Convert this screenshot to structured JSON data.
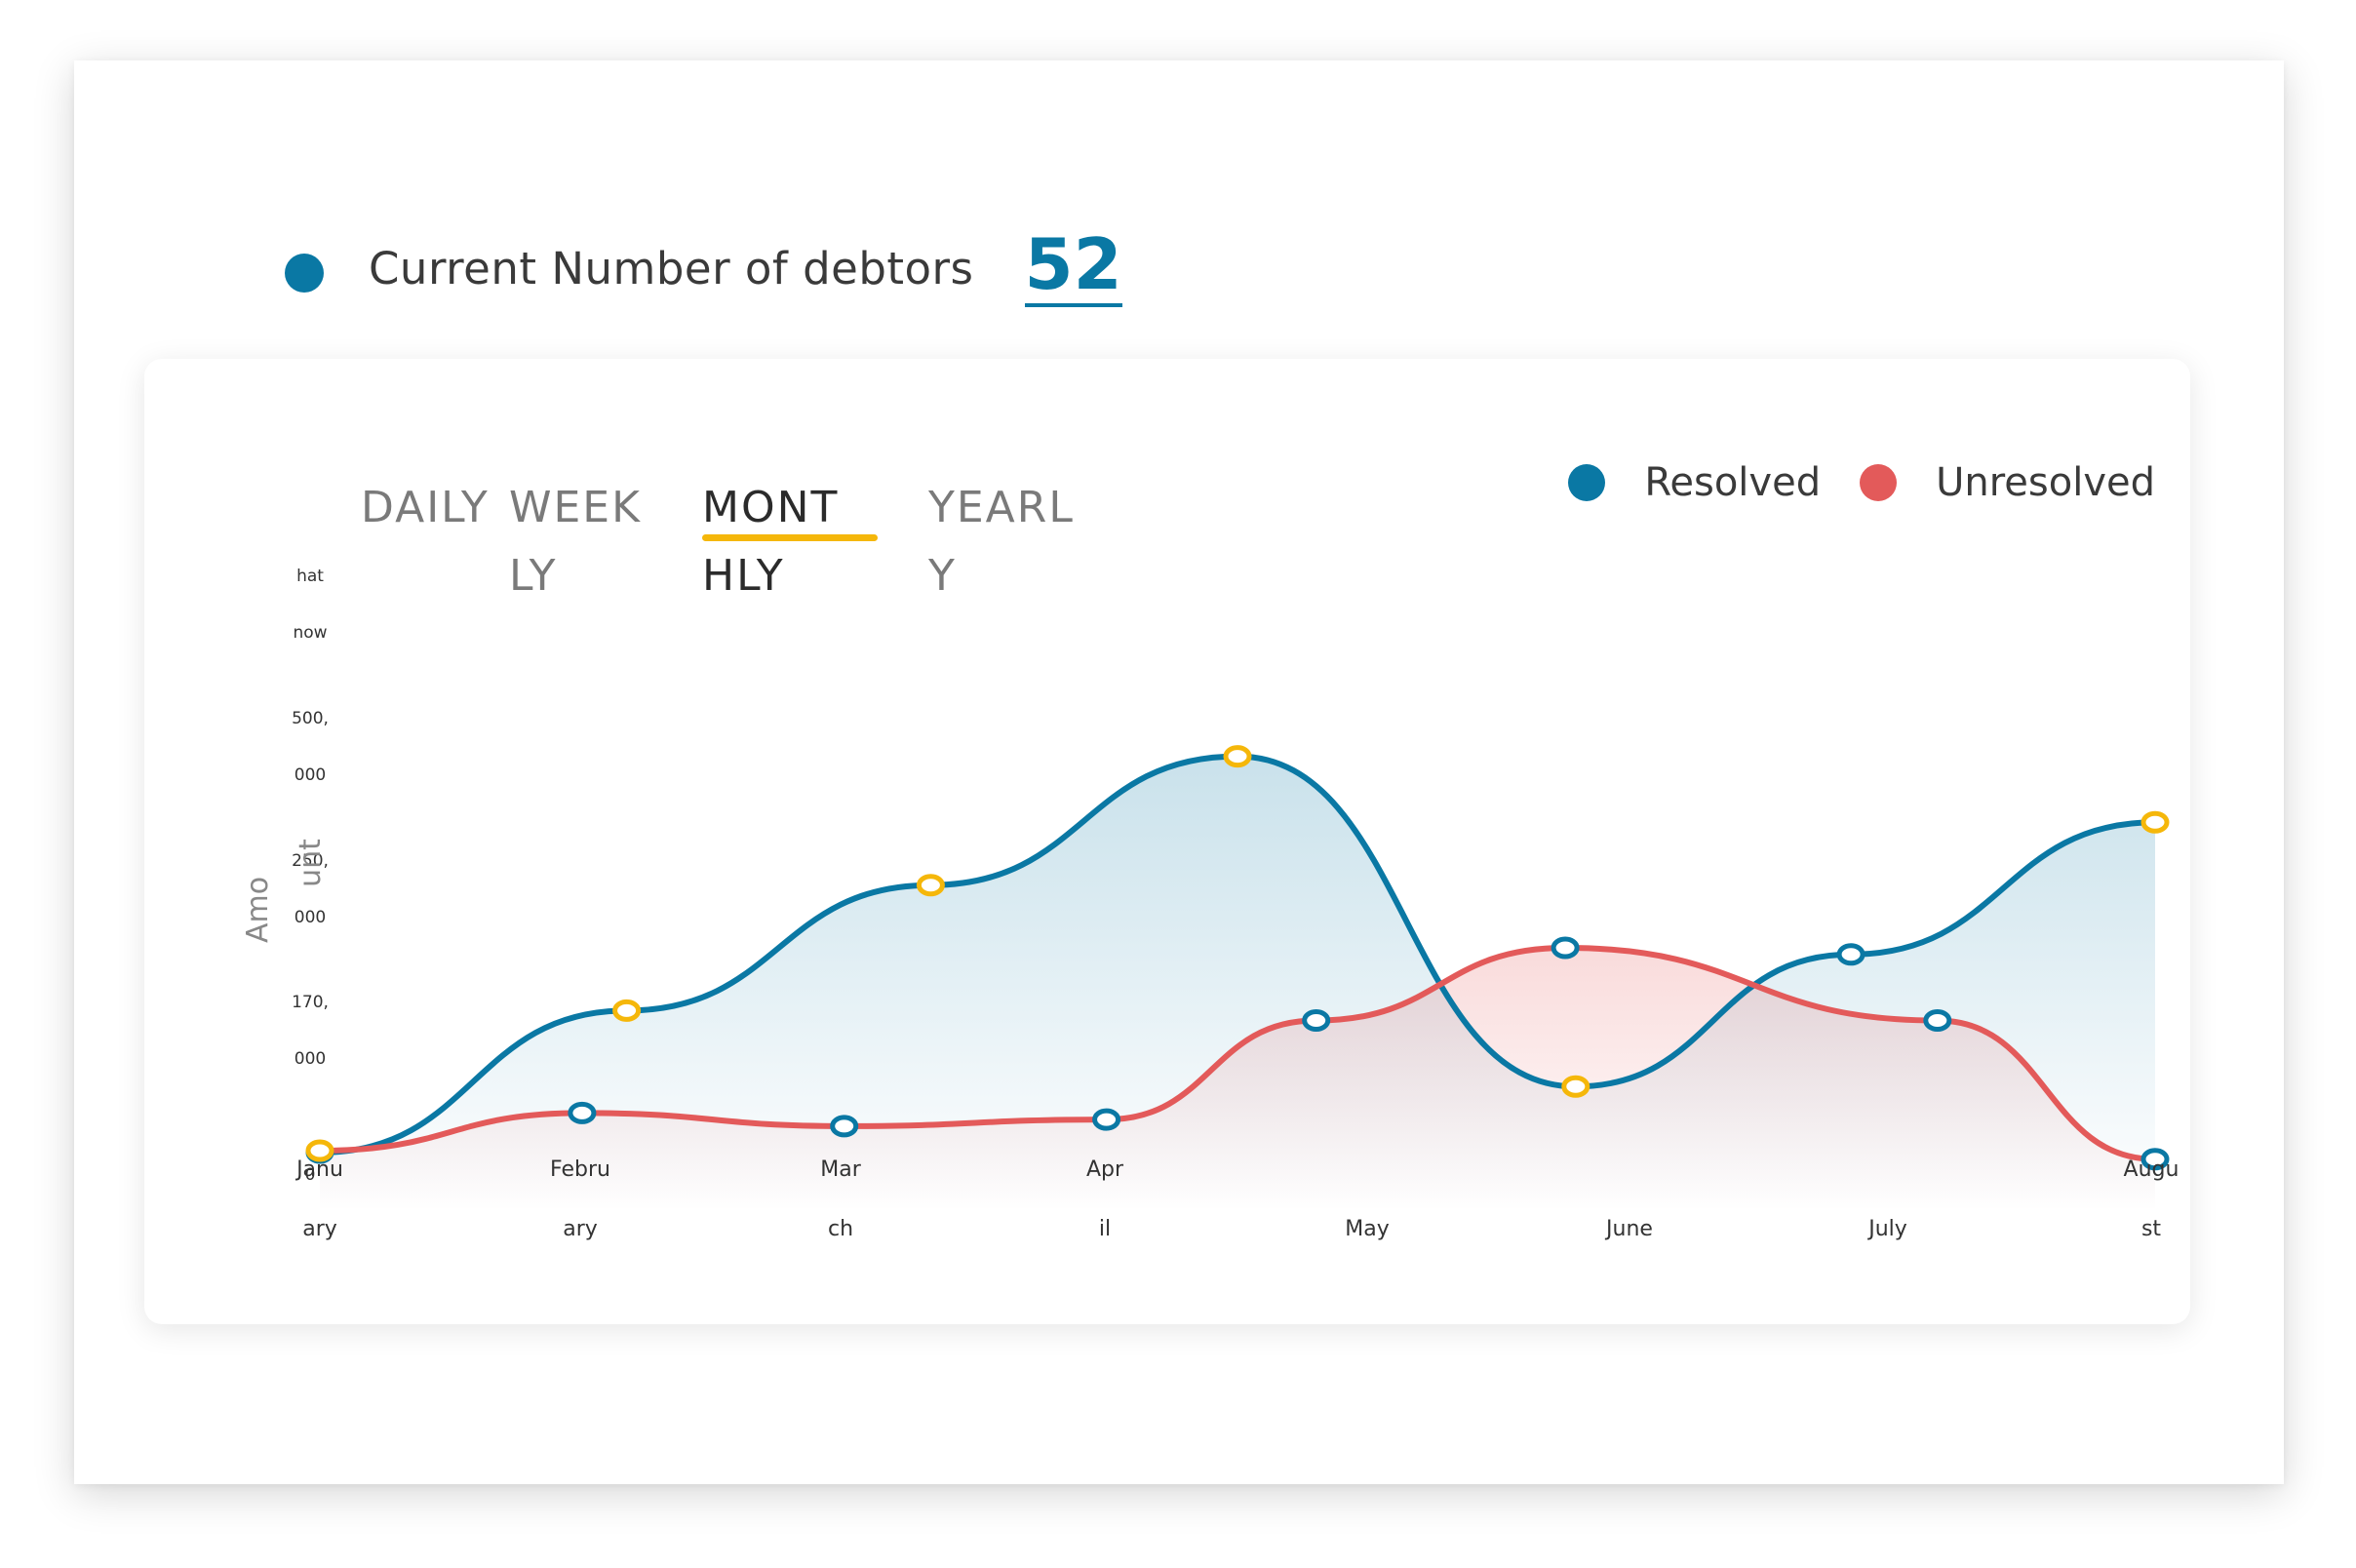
{
  "header": {
    "label": "Current Number of debtors",
    "count": "52"
  },
  "colors": {
    "resolved": "#0a78a4",
    "unresolved": "#e35a5a",
    "accent": "#f5b70a",
    "text": "#3a3a3a"
  },
  "tabs": [
    {
      "label": "DAILY",
      "active": false
    },
    {
      "label": "WEEKLY",
      "active": false
    },
    {
      "label": "MONTHLY",
      "active": true
    },
    {
      "label": "YEARLY",
      "active": false
    }
  ],
  "legend": [
    {
      "label": "Resolved",
      "color": "#0a78a4"
    },
    {
      "label": "Unresolved",
      "color": "#e35a5a"
    }
  ],
  "chart_data": {
    "type": "area",
    "xlabel": "",
    "ylabel": "Amount",
    "y_ticks": [
      {
        "label": "hat now",
        "value": 750000
      },
      {
        "label": "500,000",
        "value": 500000
      },
      {
        "label": "250,000",
        "value": 250000
      },
      {
        "label": "170,000",
        "value": 170000
      },
      {
        "label": "0",
        "value": 0
      }
    ],
    "categories": [
      "January",
      "February",
      "March",
      "April",
      "May",
      "June",
      "July",
      "August"
    ],
    "x_range": [
      0,
      7
    ],
    "ylim": [
      0,
      750000
    ],
    "grid": false,
    "legend_position": "top-right",
    "series": [
      {
        "name": "Resolved",
        "x": [
          0,
          1.17,
          2.33,
          3.5,
          4.79,
          5.84,
          7.0
        ],
        "values": [
          0,
          215000,
          405000,
          600000,
          100000,
          300000,
          500000
        ]
      },
      {
        "name": "Unresolved",
        "x": [
          0,
          1.0,
          2.0,
          3.0,
          3.8,
          4.75,
          6.17,
          7.0
        ],
        "values": [
          3000,
          60000,
          40000,
          50000,
          200000,
          310000,
          200000,
          -10000
        ]
      }
    ]
  }
}
